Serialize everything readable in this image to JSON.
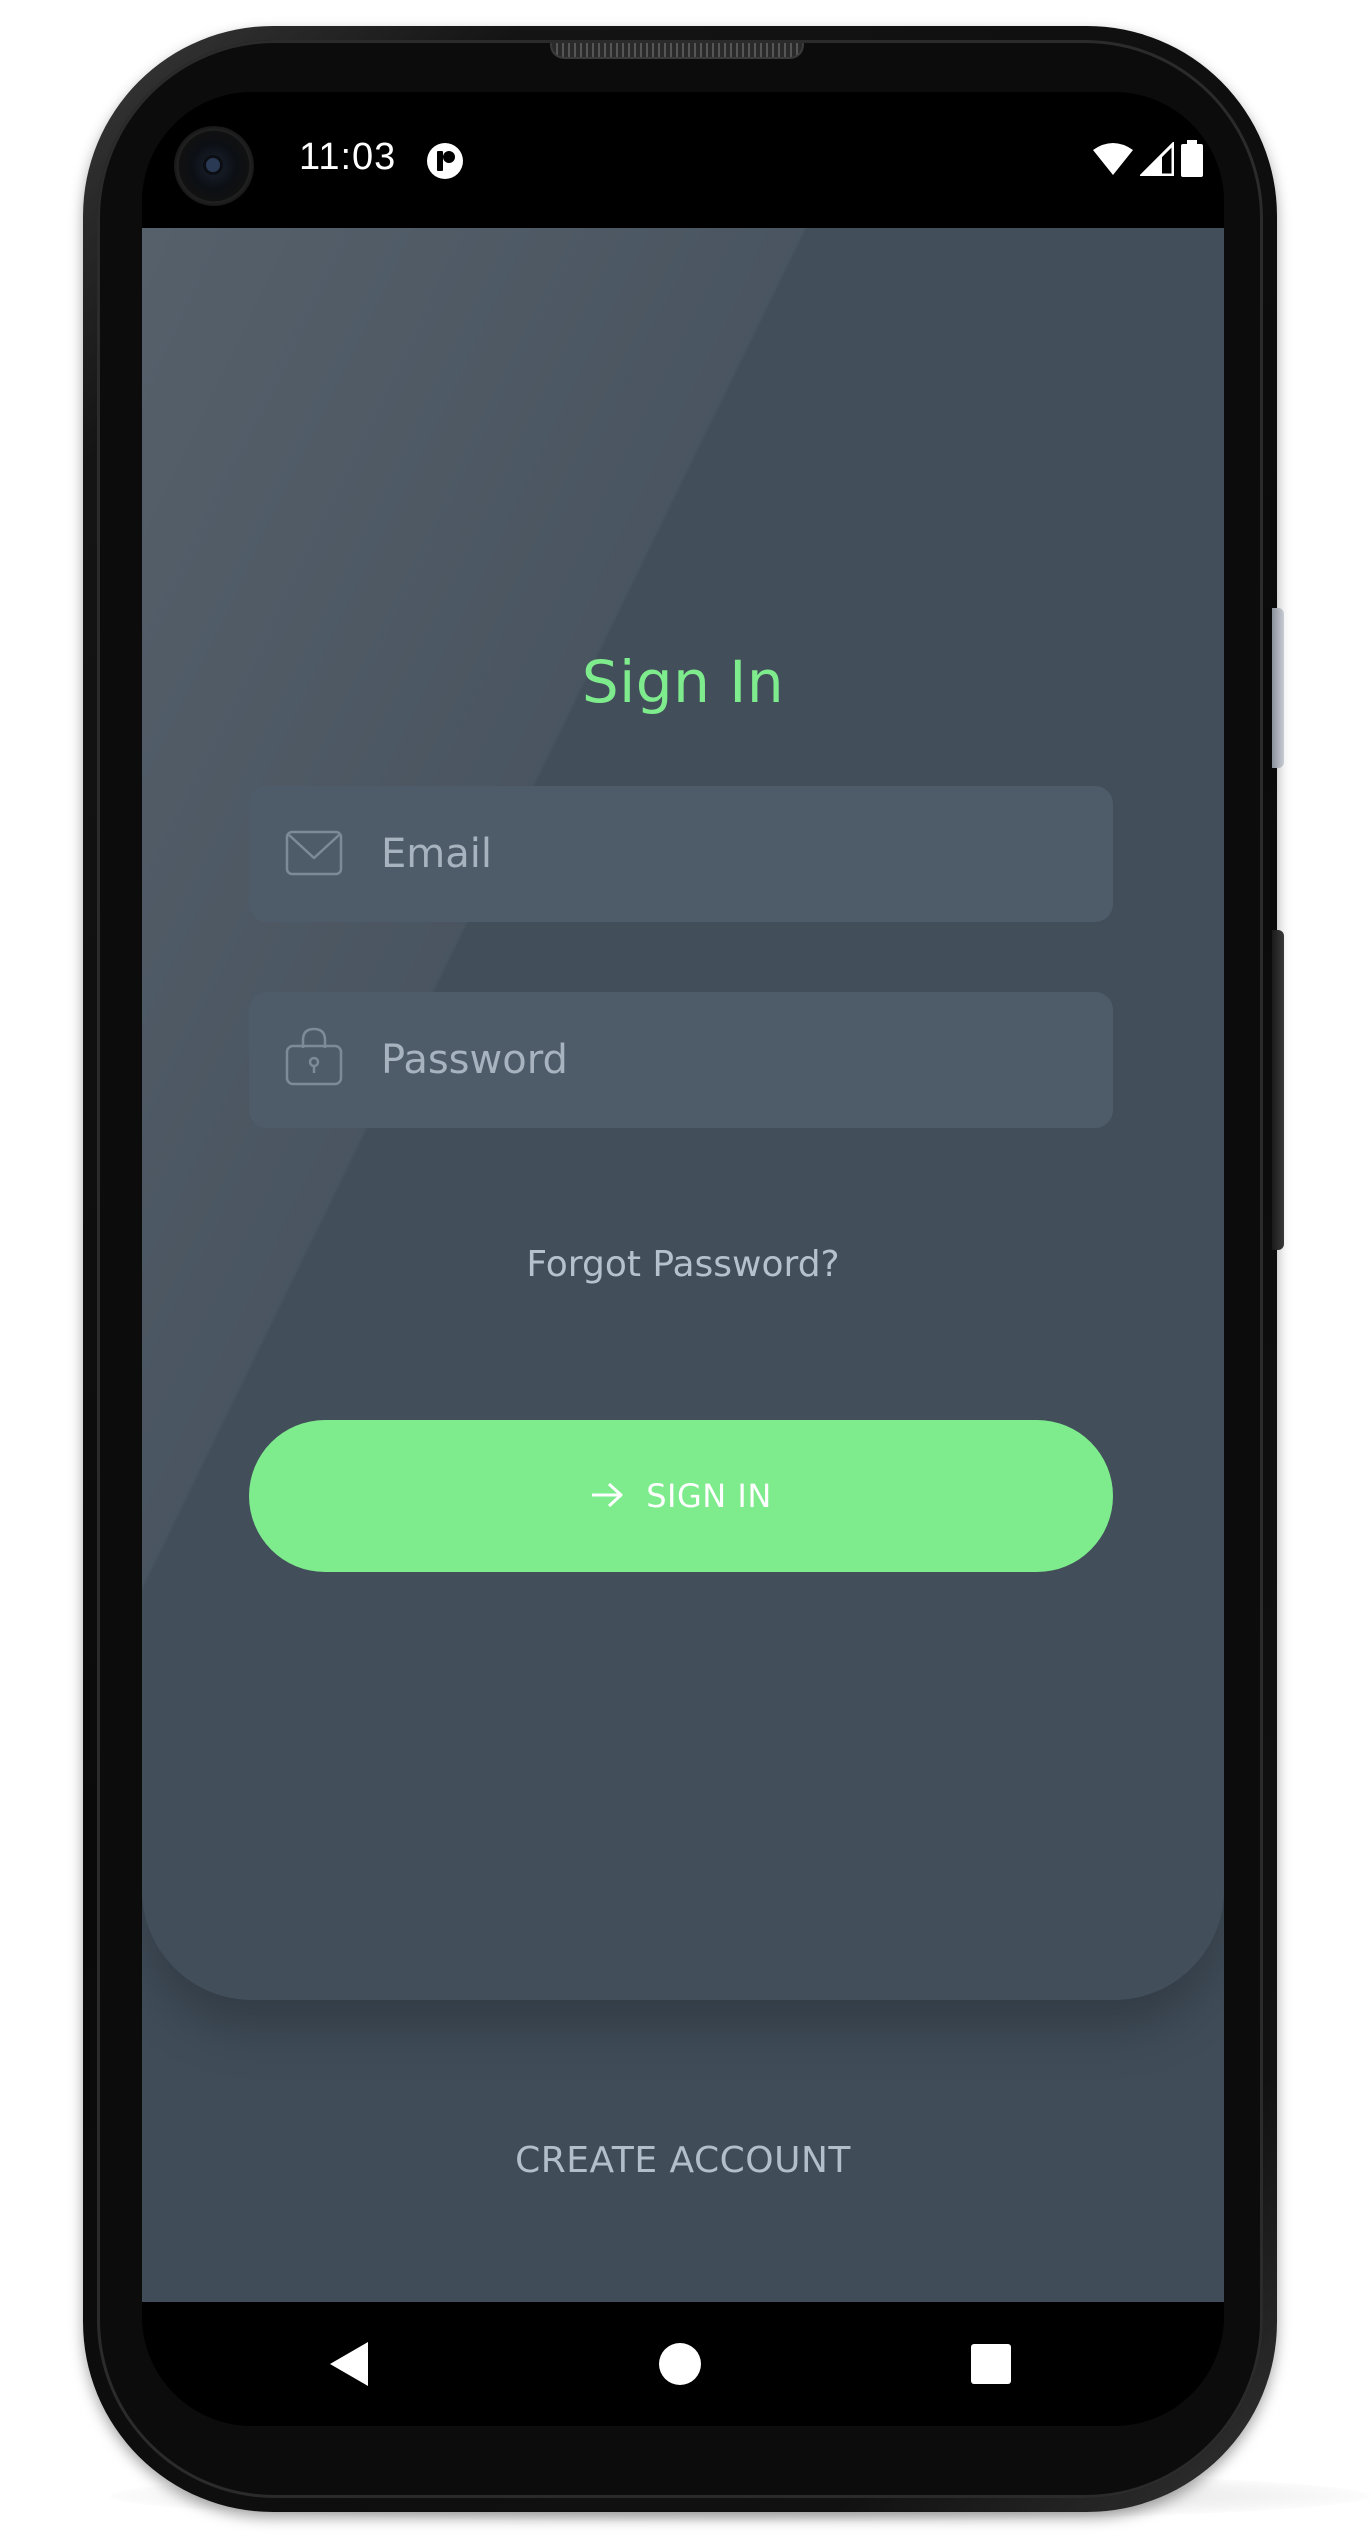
{
  "status_bar": {
    "time": "11:03",
    "icons": [
      "camera-punch-hole",
      "app-notification-icon",
      "wifi-icon",
      "cell-signal-icon",
      "battery-icon"
    ]
  },
  "signin_form": {
    "title": "Sign In",
    "email_placeholder": "Email",
    "email_icon": "envelope-icon",
    "password_placeholder": "Password",
    "password_icon": "lock-icon",
    "forgot_password": "Forgot Password?",
    "signin_button_icon": "arrow-right-icon",
    "signin_button_label": "SIGN IN"
  },
  "footer": {
    "create_account": "CREATE ACCOUNT"
  },
  "nav_bar": {
    "buttons": [
      "back-icon",
      "home-icon",
      "recents-icon"
    ]
  },
  "colors": {
    "accent": "#7eeb8c",
    "background": "#404d59",
    "card": "#424e5a",
    "field": "#4e5c6a",
    "muted_text": "#b2bec9"
  }
}
